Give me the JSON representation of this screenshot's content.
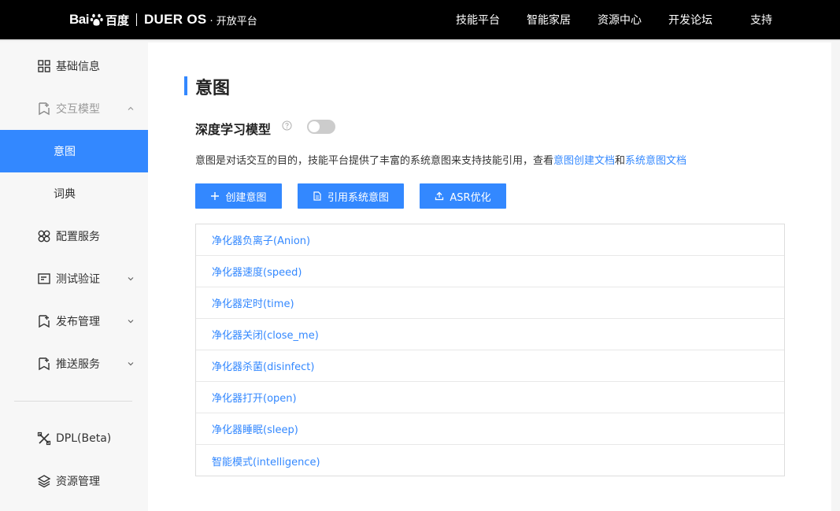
{
  "header": {
    "logo_bai": "Bai",
    "logo_du": "百度",
    "logo_dueros": "DUER OS",
    "logo_platform": "· 开放平台",
    "nav": [
      "技能平台",
      "智能家居",
      "资源中心",
      "开发论坛",
      "支持"
    ]
  },
  "sidebar": {
    "items": [
      {
        "label": "基础信息",
        "icon": "grid-icon"
      },
      {
        "label": "交互模型",
        "icon": "bookmark-plus-icon"
      },
      {
        "label": "意图"
      },
      {
        "label": "词典"
      },
      {
        "label": "配置服务",
        "icon": "clover-icon"
      },
      {
        "label": "测试验证",
        "icon": "checklist-icon"
      },
      {
        "label": "发布管理",
        "icon": "bookmark-plus-icon"
      },
      {
        "label": "推送服务",
        "icon": "bookmark-plus-icon"
      },
      {
        "label": "DPL(Beta)",
        "icon": "tools-icon"
      },
      {
        "label": "资源管理",
        "icon": "layers-icon"
      }
    ],
    "active_color": "#3388ff"
  },
  "main": {
    "title": "意图",
    "section_title": "深度学习模型",
    "desc_text": "意图是对话交互的目的，技能平台提供了丰富的系统意图来支持技能引用，查看",
    "desc_link1": "意图创建文档",
    "desc_and": "和",
    "desc_link2": "系统意图文档",
    "buttons": {
      "create": "创建意图",
      "reference": "引用系统意图",
      "asr": "ASR优化"
    },
    "intents": [
      "净化器负离子(Anion)",
      "净化器速度(speed)",
      "净化器定时(time)",
      "净化器关闭(close_me)",
      "净化器杀菌(disinfect)",
      "净化器打开(open)",
      "净化器睡眠(sleep)",
      "智能模式(intelligence)"
    ]
  }
}
